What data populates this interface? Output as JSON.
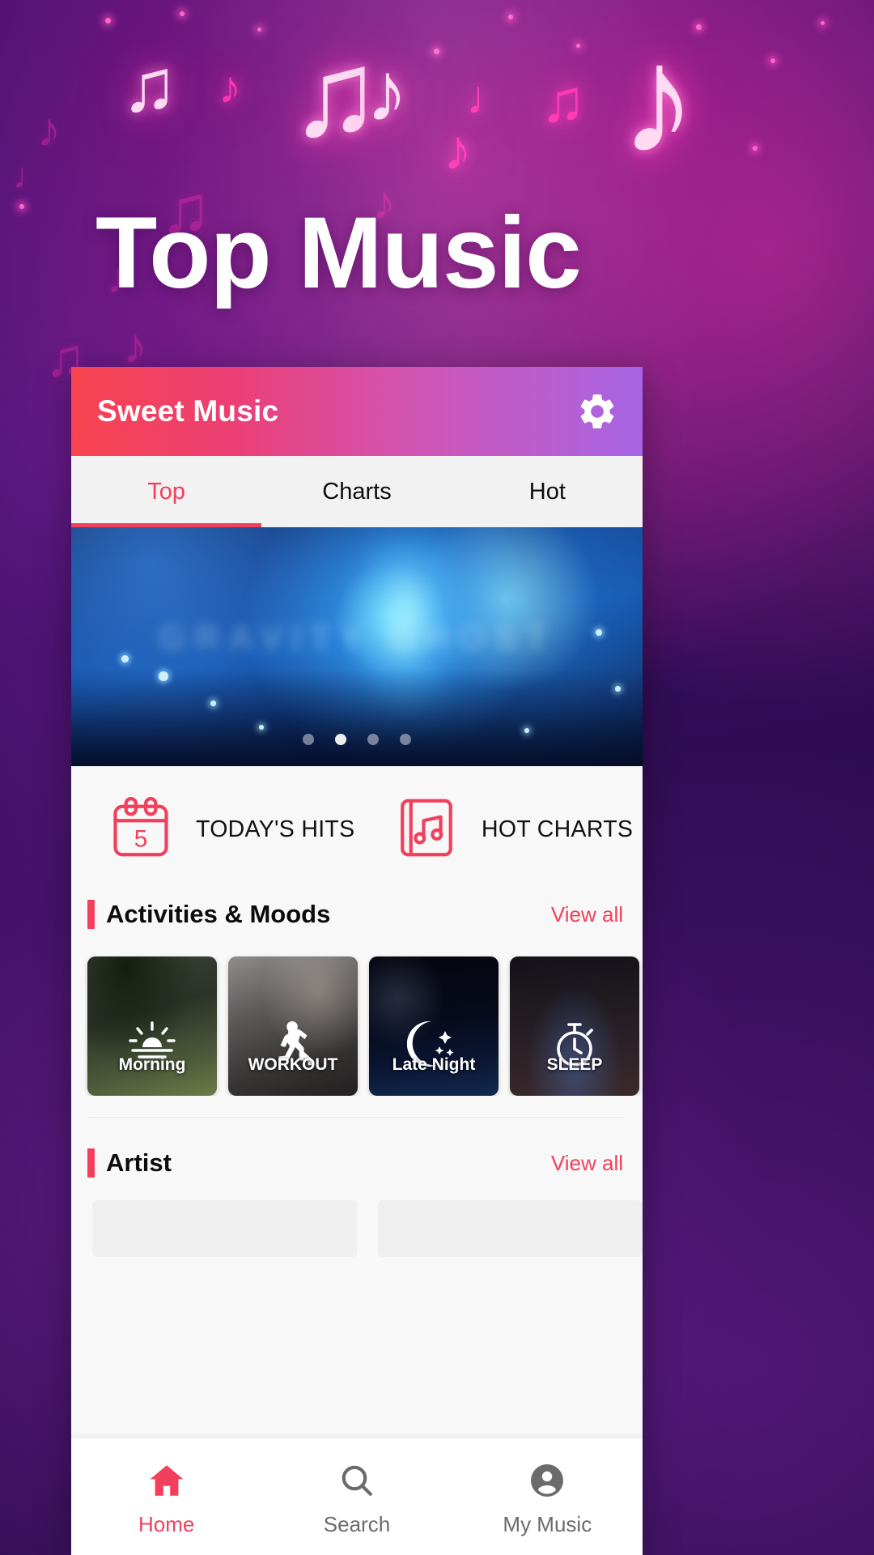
{
  "hero": {
    "title": "Top Music"
  },
  "colors": {
    "accent_pink": "#f2405c",
    "appbar_from": "#f8434f",
    "appbar_to": "#a765e4",
    "wallpaper_base": "#2b0f4a",
    "nav_inactive": "#6b6b6b"
  },
  "app_bar": {
    "title": "Sweet Music",
    "settings_icon": "gear-icon"
  },
  "tabs": {
    "active_index": 0,
    "items": [
      {
        "label": "Top"
      },
      {
        "label": "Charts"
      },
      {
        "label": "Hot"
      }
    ]
  },
  "banner": {
    "ghost_text": "GRAVITY GHOST",
    "dots_total": 4,
    "dots_active_index": 1
  },
  "quick_actions": [
    {
      "label": "TODAY'S HITS",
      "icon": "calendar-icon",
      "icon_number": "5"
    },
    {
      "label": "HOT CHARTS",
      "icon": "music-book-icon"
    }
  ],
  "sections": [
    {
      "title": "Activities & Moods",
      "view_all": "View all",
      "tiles": [
        {
          "label": "Morning",
          "icon": "sunrise-icon"
        },
        {
          "label": "WORKOUT",
          "icon": "running-person-icon"
        },
        {
          "label": "Late Night",
          "icon": "moon-stars-icon"
        },
        {
          "label": "SLEEP",
          "icon": "stopwatch-icon"
        }
      ]
    },
    {
      "title": "Artist",
      "view_all": "View all"
    }
  ],
  "bottom_nav": {
    "active_index": 0,
    "items": [
      {
        "label": "Home",
        "icon": "home-icon"
      },
      {
        "label": "Search",
        "icon": "search-icon"
      },
      {
        "label": "My Music",
        "icon": "account-circle-icon"
      }
    ]
  }
}
